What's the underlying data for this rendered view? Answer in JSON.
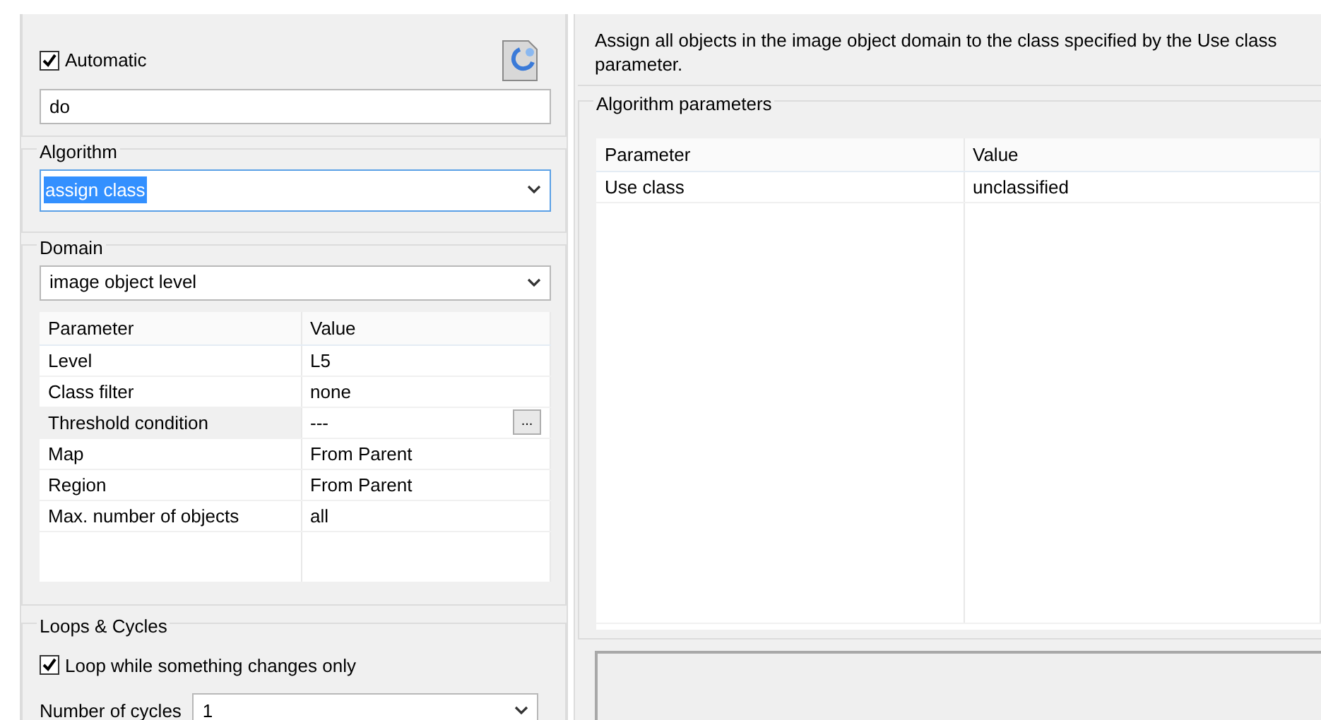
{
  "general": {
    "automatic": {
      "label": "Automatic",
      "checked": true
    },
    "name_value": "do"
  },
  "algorithm": {
    "legend": "Algorithm",
    "value": "assign class",
    "selected": true
  },
  "domain": {
    "legend": "Domain",
    "value": "image object level",
    "columns": [
      "Parameter",
      "Value"
    ],
    "rows": [
      {
        "parameter": "Level",
        "value": "L5",
        "selected": false
      },
      {
        "parameter": "Class filter",
        "value": "none",
        "selected": false
      },
      {
        "parameter": "Threshold condition",
        "value": "---",
        "selected": true,
        "button": "..."
      },
      {
        "parameter": "Map",
        "value": "From Parent",
        "selected": false
      },
      {
        "parameter": "Region",
        "value": "From Parent",
        "selected": false
      },
      {
        "parameter": "Max. number of objects",
        "value": "all",
        "selected": false
      }
    ]
  },
  "loops": {
    "legend": "Loops & Cycles",
    "loop_option": {
      "label": "Loop while something changes only",
      "checked": true
    },
    "cycles_label": "Number of cycles",
    "cycles_value": "1"
  },
  "description": "Assign all objects in the image object domain to the class specified by the Use class parameter.",
  "algorithm_parameters": {
    "legend": "Algorithm parameters",
    "columns": [
      "Parameter",
      "Value"
    ],
    "rows": [
      {
        "parameter": "Use class",
        "value": "unclassified"
      }
    ]
  }
}
